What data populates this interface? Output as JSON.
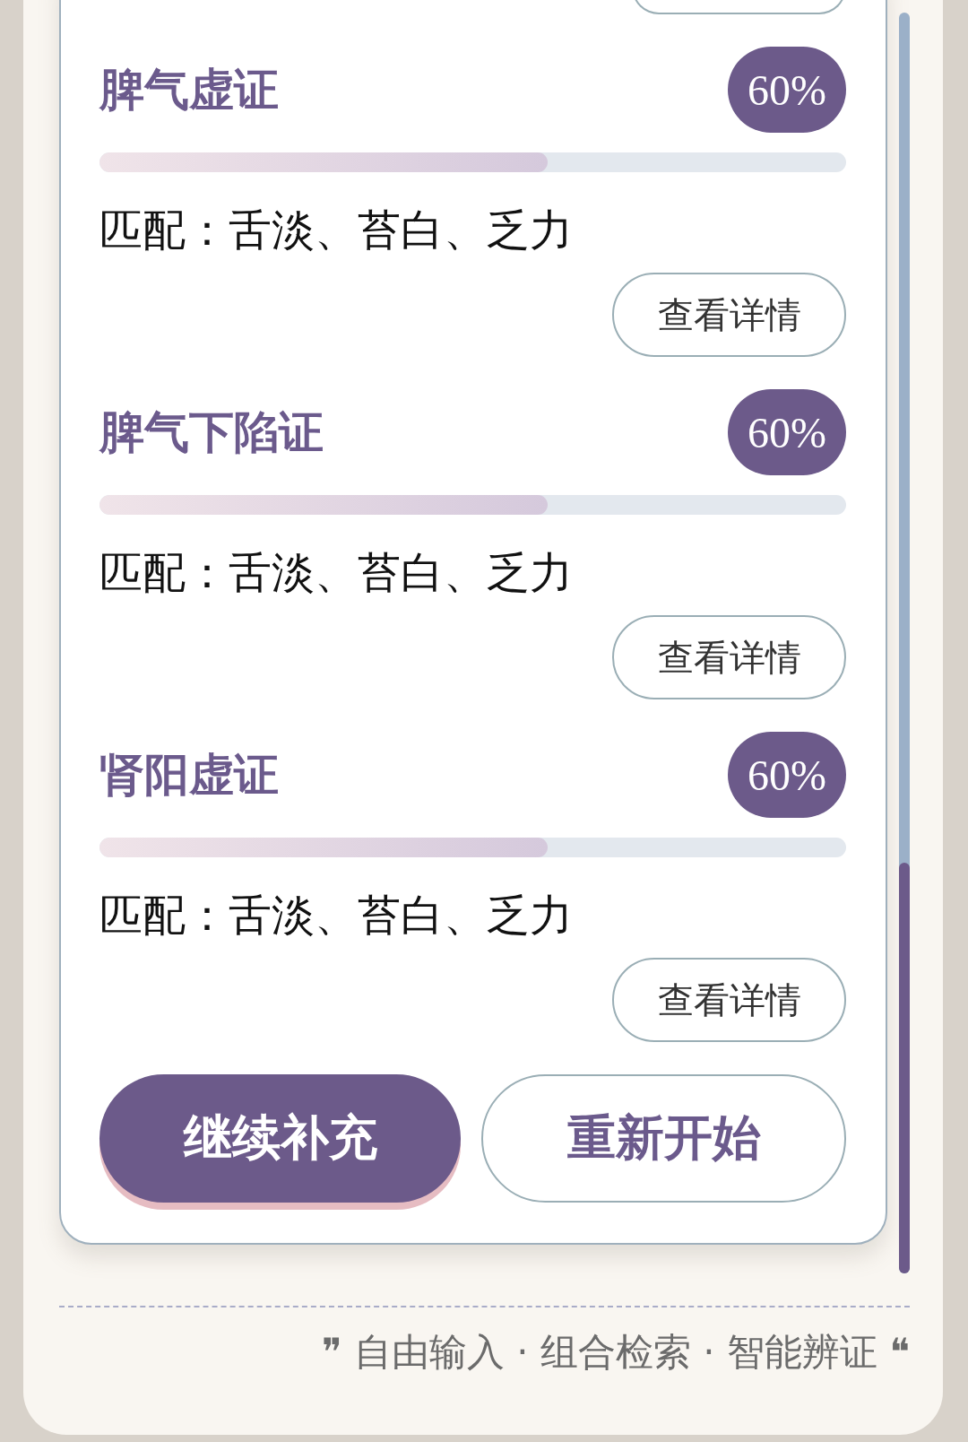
{
  "results": [
    {
      "name": "脾气虚证",
      "percent": "60%",
      "level": 0.6,
      "match": "匹配：舌淡、苔白、乏力",
      "button": "查看详情"
    },
    {
      "name": "脾气下陷证",
      "percent": "60%",
      "level": 0.6,
      "match": "匹配：舌淡、苔白、乏力",
      "button": "查看详情"
    },
    {
      "name": "肾阳虚证",
      "percent": "60%",
      "level": 0.6,
      "match": "匹配：舌淡、苔白、乏力",
      "button": "查看详情"
    }
  ],
  "actions": [
    {
      "label": "继续补充",
      "kind": "primary"
    },
    {
      "label": "重新开始",
      "kind": "secondary"
    }
  ],
  "footer": "❞ 自由输入 · 组合检索 · 智能辨证 ❝"
}
